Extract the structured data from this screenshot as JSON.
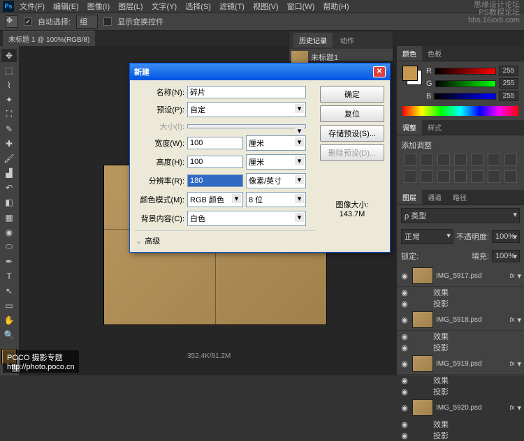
{
  "menubar": [
    "文件(F)",
    "编辑(E)",
    "图像(I)",
    "图层(L)",
    "文字(Y)",
    "选择(S)",
    "滤镜(T)",
    "视图(V)",
    "窗口(W)",
    "帮助(H)"
  ],
  "optbar": {
    "auto_select": "自动选择:",
    "group": "组",
    "show_transform": "显示变换控件"
  },
  "doctab": "未标题 1 @ 100%(RGB/8)",
  "history": {
    "tab1": "历史记录",
    "tab2": "动作",
    "item": "未标题1"
  },
  "dialog": {
    "title": "新建",
    "name_label": "名称(N):",
    "name_value": "碎片",
    "preset_label": "预设(P):",
    "preset_value": "自定",
    "size_label": "大小(I):",
    "width_label": "宽度(W):",
    "width_value": "100",
    "width_unit": "厘米",
    "height_label": "高度(H):",
    "height_value": "100",
    "height_unit": "厘米",
    "res_label": "分辨率(R):",
    "res_value": "180",
    "res_unit": "像素/英寸",
    "mode_label": "颜色模式(M):",
    "mode_value": "RGB 颜色",
    "bit_value": "8 位",
    "bg_label": "背景内容(C):",
    "bg_value": "白色",
    "advanced": "高级",
    "imgsize_label": "图像大小:",
    "imgsize_value": "143.7M",
    "btn_ok": "确定",
    "btn_reset": "复位",
    "btn_save": "存储预设(S)...",
    "btn_del": "删除预设(D)..."
  },
  "color_panel": {
    "tab1": "颜色",
    "tab2": "色板",
    "r": "R",
    "g": "G",
    "b": "B",
    "val": "255"
  },
  "adj_panel": {
    "tab1": "调整",
    "tab2": "样式",
    "title": "添加调整"
  },
  "layers_panel": {
    "tab1": "图层",
    "tab2": "通道",
    "tab3": "路径",
    "kind": "ρ 类型",
    "blend": "正常",
    "opacity_label": "不透明度:",
    "opacity": "100%",
    "lock": "锁定:",
    "fill_label": "填充:",
    "fill": "100%",
    "layers": [
      {
        "name": "IMG_5917.psd"
      },
      {
        "name": "IMG_5918.psd"
      },
      {
        "name": "IMG_5919.psd"
      },
      {
        "name": "IMG_5920.psd"
      }
    ],
    "fx_label": "效果",
    "shadow": "投影",
    "fx": "fx"
  },
  "status": "352.4K/81.2M",
  "watermark": {
    "l1": "思缘设计论坛",
    "l2": "bbs.16xx8.com",
    "l3": "PS教程论坛"
  },
  "poco": {
    "l1": "POCO 摄影专题",
    "l2": "http://photo.poco.cn"
  }
}
